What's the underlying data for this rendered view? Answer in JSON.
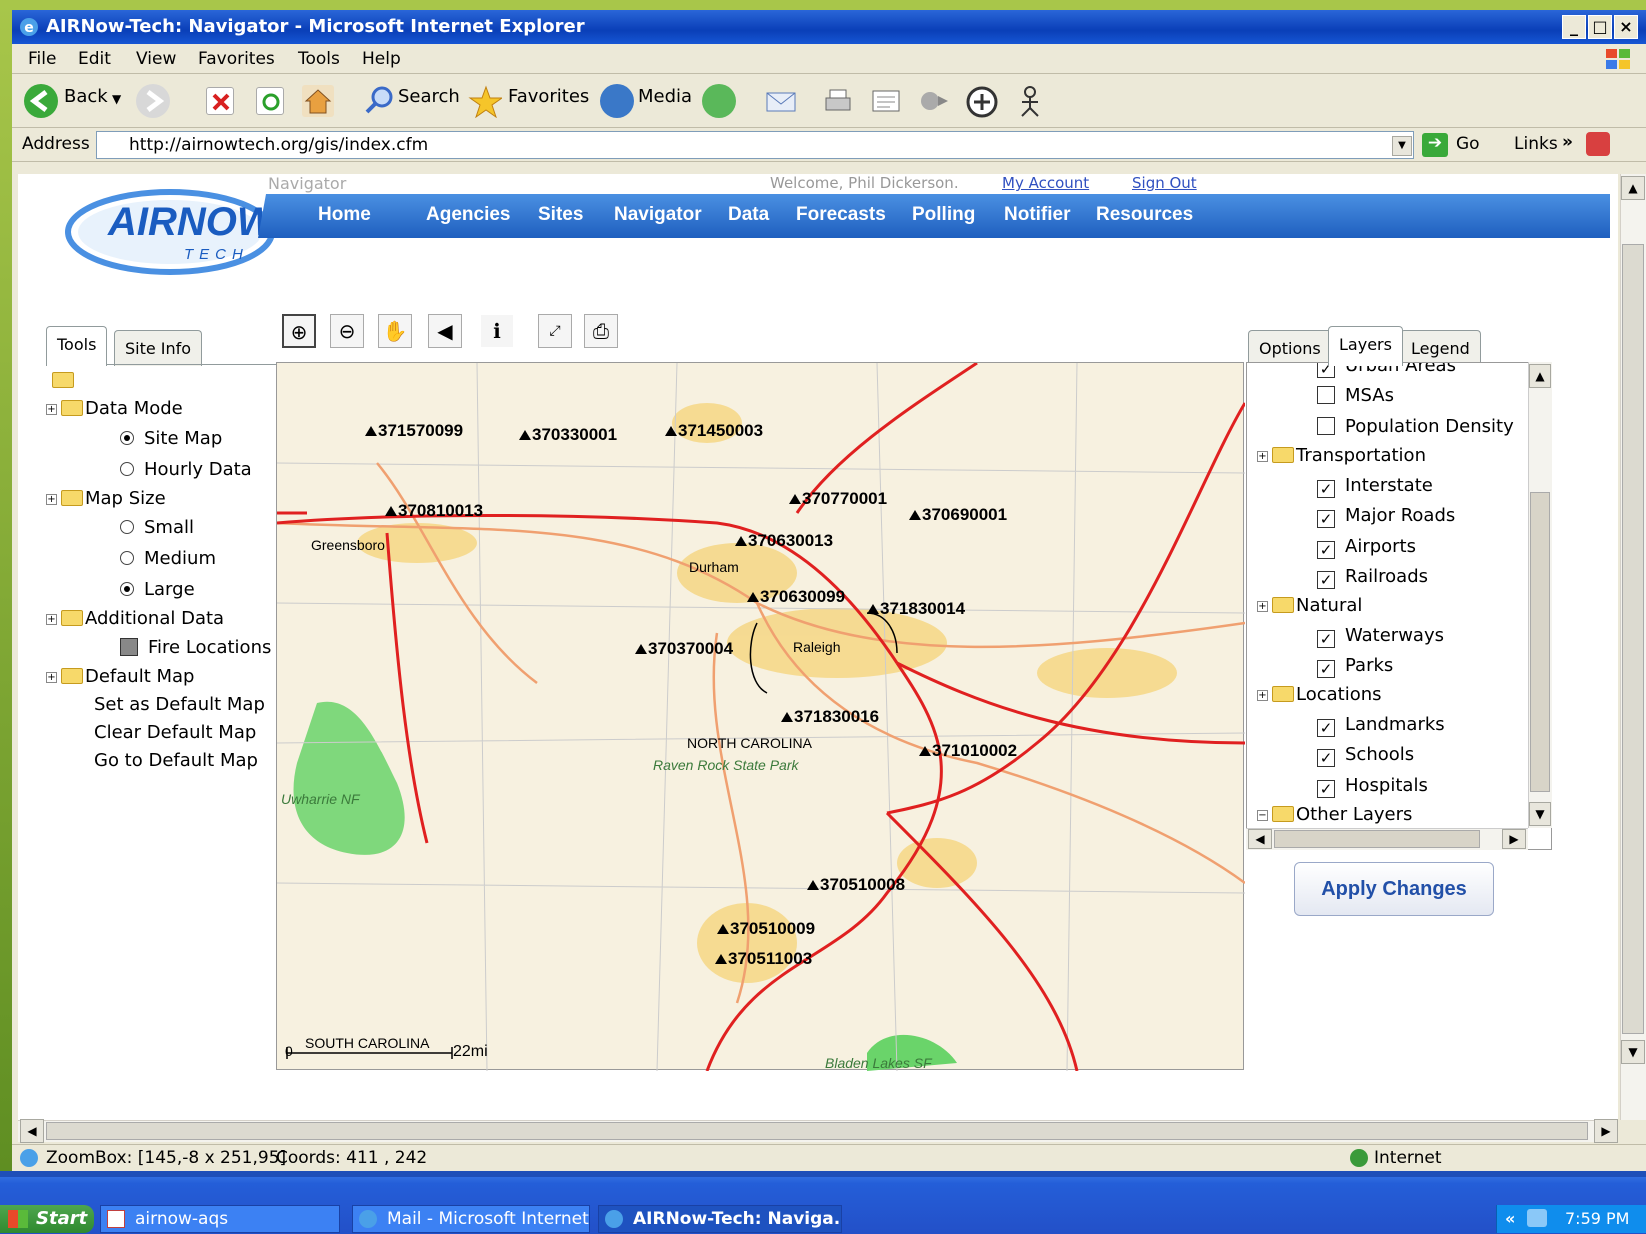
{
  "window": {
    "title": "AIRNow-Tech: Navigator - Microsoft Internet Explorer"
  },
  "menu": [
    "File",
    "Edit",
    "View",
    "Favorites",
    "Tools",
    "Help"
  ],
  "toolbar": {
    "back": "Back",
    "search": "Search",
    "favorites": "Favorites",
    "media": "Media"
  },
  "address": {
    "label": "Address",
    "url": "http://airnowtech.org/gis/index.cfm",
    "go": "Go",
    "links": "Links"
  },
  "page": {
    "toptext": "Navigator",
    "welcome": "Welcome, Phil Dickerson.",
    "my_account": "My Account",
    "sign_out": "Sign Out",
    "logo_top": "AIRNOW",
    "logo_bottom": "TECH",
    "nav": [
      "Home",
      "Agencies",
      "Sites",
      "Navigator",
      "Data",
      "Forecasts",
      "Polling",
      "Notifier",
      "Resources"
    ]
  },
  "left_tabs": [
    "Tools",
    "Site Info"
  ],
  "tree": {
    "data_mode": "Data Mode",
    "site_map": "Site Map",
    "hourly_data": "Hourly Data",
    "map_size": "Map Size",
    "small": "Small",
    "medium": "Medium",
    "large": "Large",
    "additional_data": "Additional Data",
    "fire_locations": "Fire Locations",
    "default_map": "Default Map",
    "set_default": "Set as Default Map",
    "clear_default": "Clear Default Map",
    "go_default": "Go to Default Map"
  },
  "map": {
    "sites": [
      "371570099",
      "370330001",
      "371450003",
      "370810013",
      "370770001",
      "370690001",
      "370630013",
      "370630099",
      "371830014",
      "370370004",
      "371830016",
      "371010002",
      "370510008",
      "370510009",
      "370511003"
    ],
    "cities": [
      "Greensboro",
      "Durham",
      "Raleigh",
      "NORTH CAROLINA",
      "SOUTH CAROLINA"
    ],
    "parks": [
      "Raven Rock State Park",
      "Uwharrie NF",
      "Bladen Lakes SF"
    ],
    "scale_zero": "0",
    "scale_label": "22mi"
  },
  "right_tabs": [
    "Options",
    "Layers",
    "Legend"
  ],
  "layers": {
    "urban_areas": "Urban Areas",
    "msas": "MSAs",
    "population_density": "Population Density",
    "transportation": "Transportation",
    "interstate": "Interstate",
    "major_roads": "Major Roads",
    "airports": "Airports",
    "railroads": "Railroads",
    "natural": "Natural",
    "waterways": "Waterways",
    "parks": "Parks",
    "locations": "Locations",
    "landmarks": "Landmarks",
    "schools": "Schools",
    "hospitals": "Hospitals",
    "other_layers": "Other Layers"
  },
  "apply": "Apply Changes",
  "status": {
    "zoombox": "ZoomBox: [145,-8 x 251,95]",
    "coords": "Coords: 411 , 242",
    "zone": "Internet"
  },
  "taskbar": {
    "start": "Start",
    "items": [
      "airnow-aqs",
      "Mail - Microsoft Internet ...",
      "AIRNow-Tech: Naviga..."
    ],
    "time": "7:59 PM"
  },
  "colors": {
    "accent": "#1f5fbf",
    "interstate": "#e02020",
    "road": "#f0a070",
    "urban": "#f5d88a",
    "park": "#6ad46a"
  }
}
